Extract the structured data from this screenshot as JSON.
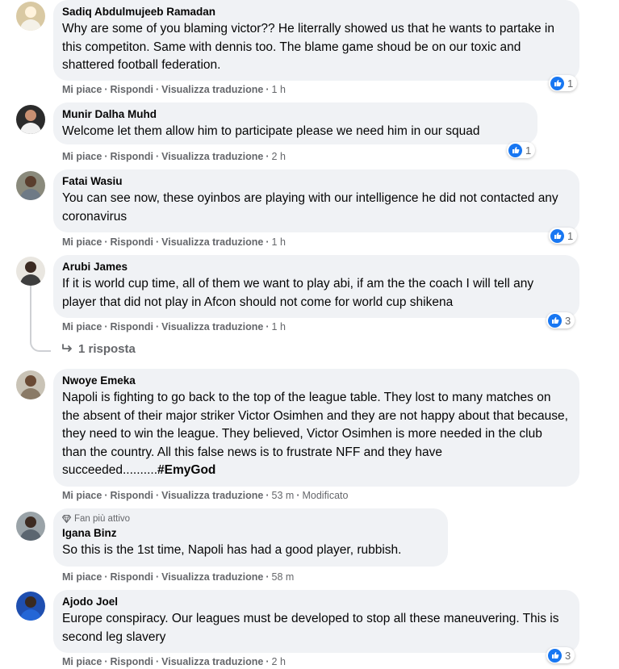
{
  "actions": {
    "like": "Mi piace",
    "reply": "Rispondi",
    "translate": "Visualizza traduzione"
  },
  "comments": [
    {
      "author": "Sadiq Abdulmujeeb Ramadan",
      "text": "Why are some of you blaming victor?? He literrally showed us that he wants to partake in this competiton. Same with dennis too. The blame game shoud be on our toxic and shattered football federation.",
      "time": "1 h",
      "reactions": "1"
    },
    {
      "author": "Munir Dalha Muhd",
      "text": "Welcome let them allow him to participate please we need him in our squad",
      "time": "2 h",
      "reactions": "1"
    },
    {
      "author": "Fatai Wasiu",
      "text": "You can see now, these oyinbos are playing with our intelligence he did not contacted any coronavirus",
      "time": "1 h",
      "reactions": "1"
    },
    {
      "author": "Arubi James",
      "text": "If it is world cup time, all of them we want to play abi, if am the the coach I will tell any player that did not play in Afcon should not come for world cup shikena",
      "time": "1 h",
      "reactions": "3",
      "replies": "1 risposta"
    },
    {
      "author": "Nwoye Emeka",
      "text": "Napoli is fighting to go back to the top of the league table. They lost to many matches on the absent of their major striker Victor Osimhen and they are not happy about that because, they need to win the league. They believed, Victor Osimhen is more needed in the club than the country. All this false news is to frustrate NFF and they have succeeded..........",
      "hashtag": "#EmyGod",
      "time": "53 m",
      "edited": "Modificato"
    },
    {
      "badge": "Fan più attivo",
      "author": "Igana Binz",
      "text": "So this is the 1st time, Napoli has had a good player, rubbish.",
      "time": "58 m"
    },
    {
      "author": "Ajodo Joel",
      "text": "Europe conspiracy. Our leagues must be developed to stop all these maneuvering. This is second leg slavery",
      "time": "2 h",
      "reactions": "3"
    }
  ],
  "colors": {
    "bubble": "#f0f2f5",
    "meta": "#65676b",
    "like": "#1877f2"
  },
  "icons": {
    "like": "thumbs-up-icon",
    "reply_arrow": "reply-arrow-icon",
    "badge": "diamond-icon"
  }
}
